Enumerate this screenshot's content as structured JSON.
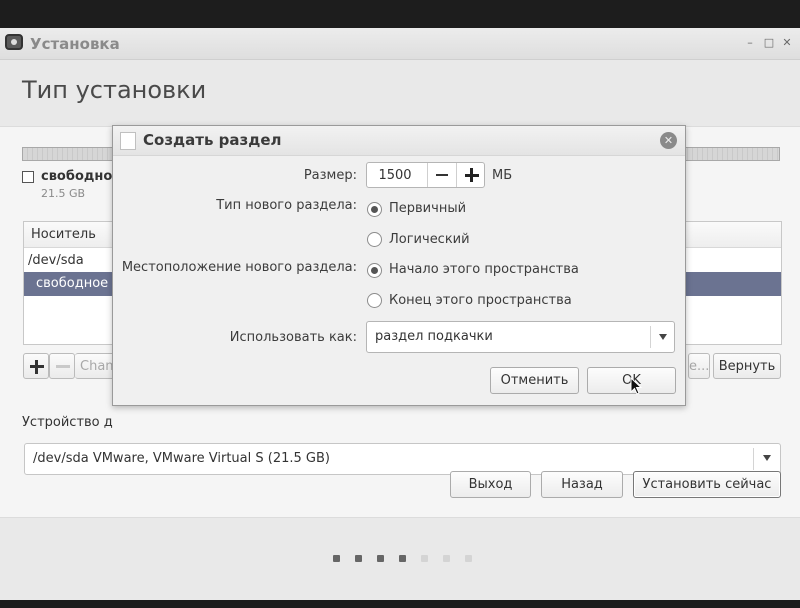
{
  "window": {
    "title": "Установка",
    "page_title": "Тип установки",
    "controls": {
      "minimize": "–",
      "maximize": "□",
      "close": "✕"
    }
  },
  "content": {
    "free_space": {
      "label": "свободно",
      "size": "21.5 GB"
    },
    "table": {
      "columns": [
        "Носитель"
      ],
      "rows": [
        {
          "device": "/dev/sda"
        },
        {
          "device": "свободное"
        }
      ]
    },
    "buttons": {
      "change": "Chan",
      "advanced": "е...",
      "revert": "Вернуть"
    },
    "bootloader_label": "Устройство д",
    "bootloader_device": "/dev/sda  VMware, VMware Virtual S (21.5 GB)"
  },
  "navigation": {
    "quit": "Выход",
    "back": "Назад",
    "install": "Установить сейчас"
  },
  "progress": {
    "total_steps": 7,
    "completed_steps": 4,
    "active_color": "#666666",
    "inactive_color": "#d4d4d4"
  },
  "dialog": {
    "title": "Создать раздел",
    "size": {
      "label": "Размер:",
      "value": "1500",
      "unit": "МБ"
    },
    "type": {
      "label": "Тип нового раздела:",
      "options": [
        {
          "label": "Первичный",
          "checked": true
        },
        {
          "label": "Логический",
          "checked": false
        }
      ]
    },
    "location": {
      "label": "Местоположение нового раздела:",
      "options": [
        {
          "label": "Начало этого пространства",
          "checked": true
        },
        {
          "label": "Конец этого пространства",
          "checked": false
        }
      ]
    },
    "use_as": {
      "label": "Использовать как:",
      "value": "раздел подкачки"
    },
    "buttons": {
      "cancel": "Отменить",
      "ok": "OK"
    }
  },
  "colors": {
    "selection": "#6b7391",
    "window_bg": "#e9e9e9"
  }
}
